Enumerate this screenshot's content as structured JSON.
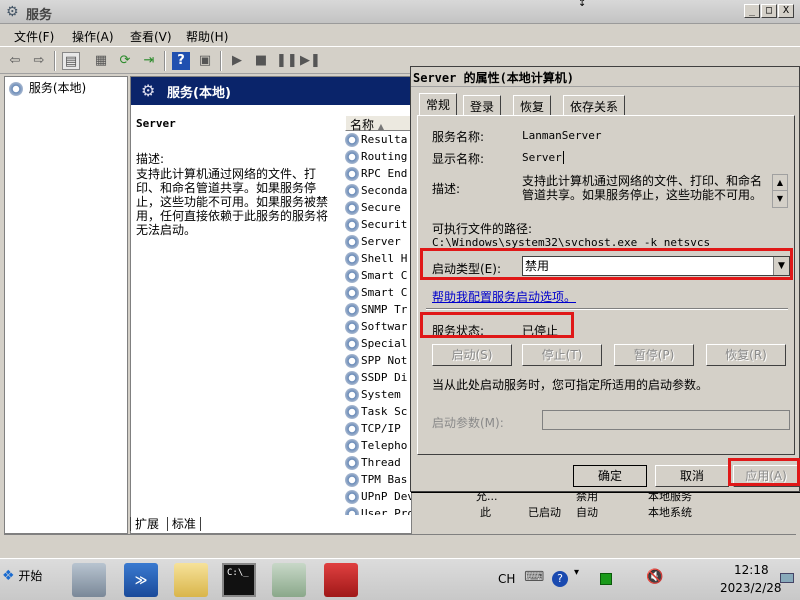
{
  "window": {
    "title": "服务",
    "controls": [
      "_",
      "□",
      "X"
    ]
  },
  "menu": [
    {
      "label": "文件(F)"
    },
    {
      "label": "操作(A)"
    },
    {
      "label": "查看(V)"
    },
    {
      "label": "帮助(H)"
    }
  ],
  "tree": {
    "root_label": "服务(本地)"
  },
  "pane": {
    "header": "服务(本地)",
    "service_name": "Server",
    "desc_label": "描述:",
    "desc_text": "支持此计算机通过网络的文件、打印、和命名管道共享。如果服务停止，这些功能不可用。如果服务被禁用，任何直接依赖于此服务的服务将无法启动。"
  },
  "list": {
    "column_header": "名称",
    "rows": [
      "Resulta",
      "Routing",
      "RPC End",
      "Seconda",
      "Secure",
      "Securit",
      "Server",
      "Shell H",
      "Smart C",
      "Smart C",
      "SNMP Tr",
      "Softwar",
      "Special",
      "SPP Not",
      "SSDP Di",
      "System",
      "Task Sc",
      "TCP/IP",
      "Telepho",
      "Thread",
      "TPM Bas",
      "UPnP Device Host",
      "User Profile S"
    ],
    "extra_row_upnp": [
      "允...",
      "",
      "禁用",
      "本地服务"
    ],
    "extra_row_user": [
      "此",
      "已启动",
      "自动",
      "本地系统"
    ]
  },
  "bottom_tabs": [
    "扩展",
    "标准"
  ],
  "dialog": {
    "title": "Server 的属性(本地计算机)",
    "tabs": [
      "常规",
      "登录",
      "恢复",
      "依存关系"
    ],
    "service_name_label": "服务名称:",
    "service_name_value": "LanmanServer",
    "display_name_label": "显示名称:",
    "display_name_value": "Server",
    "description_label": "描述:",
    "description_value": "支持此计算机通过网络的文件、打印、和命名管道共享。如果服务停止，这些功能不可用。",
    "exe_path_label": "可执行文件的路径:",
    "exe_path_value": "C:\\Windows\\system32\\svchost.exe -k netsvcs",
    "startup_type_label": "启动类型(E):",
    "startup_type_value": "禁用",
    "help_link": "帮助我配置服务启动选项。",
    "service_status_label": "服务状态:",
    "service_status_value": "已停止",
    "start_button": "启动(S)",
    "stop_button": "停止(T)",
    "pause_button": "暂停(P)",
    "resume_button": "恢复(R)",
    "start_param_hint": "当从此处启动服务时，您可指定所适用的启动参数。",
    "start_param_label": "启动参数(M):",
    "ok_button": "确定",
    "cancel_button": "取消",
    "apply_button": "应用(A)"
  },
  "taskbar": {
    "start_label": "开始",
    "lang": "CH",
    "time": "12:18",
    "date": "2023/2/28"
  },
  "colors": {
    "pane_header_bg": "#0a246a",
    "highlight_box": "#e01818"
  }
}
